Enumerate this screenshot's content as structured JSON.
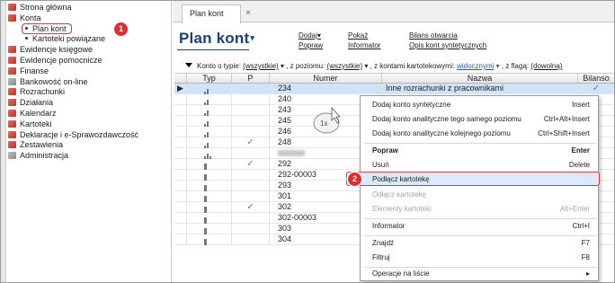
{
  "sidebar": {
    "items": [
      {
        "label": "Strona główna",
        "icon": "red"
      },
      {
        "label": "Konta",
        "icon": "red"
      },
      {
        "label": "Plan kont",
        "level": 2
      },
      {
        "label": "Kartoteki powiązane",
        "level": 2
      },
      {
        "label": "Ewidencje księgowe",
        "icon": "red"
      },
      {
        "label": "Ewidencje pomocnicze",
        "icon": "red"
      },
      {
        "label": "Finanse",
        "icon": "red"
      },
      {
        "label": "Bankowość on-line",
        "icon": "gray"
      },
      {
        "label": "Rozrachunki",
        "icon": "red"
      },
      {
        "label": "Działania",
        "icon": "red"
      },
      {
        "label": "Kalendarz",
        "icon": "red"
      },
      {
        "label": "Kartoteki",
        "icon": "red"
      },
      {
        "label": "Deklaracje i e-Sprawozdawczość",
        "icon": "red"
      },
      {
        "label": "Zestawienia",
        "icon": "red"
      },
      {
        "label": "Administracja",
        "icon": "gray"
      }
    ]
  },
  "badges": {
    "one": "1",
    "two": "2"
  },
  "tab": {
    "label": "Plan kont",
    "close": "×"
  },
  "page": {
    "title": "Plan kont",
    "title_arrow": "▾"
  },
  "links": {
    "col1": [
      "Dodaj▾",
      "Popraw"
    ],
    "col2": [
      "Pokaż",
      "Informator"
    ],
    "col3": [
      "Bilans otwarcia",
      "Opis kont syntetycznych"
    ]
  },
  "filter": {
    "t1": "Konto o typie: ",
    "v1": "(wszystkie)",
    "t2": " , z poziomu: ",
    "v2": "(wszystkie)",
    "t3": " , z kontami kartotekowymi: ",
    "v3": "widocznymi",
    "t4": " , z flagą: ",
    "v4": "(dowolną)"
  },
  "grid": {
    "headers": {
      "typ": "Typ",
      "p": "P",
      "numer": "Numer",
      "nazwa": "Nazwa",
      "bilanso": "Bilanso"
    },
    "rows": [
      {
        "numer": "234",
        "nazwa": "Inne rozrachunki z pracownikami",
        "p": "",
        "check": "✓",
        "sel": true
      },
      {
        "numer": "240",
        "p": "",
        "check": ""
      },
      {
        "numer": "243",
        "p": "",
        "check": ""
      },
      {
        "numer": "245",
        "p": "",
        "check": ""
      },
      {
        "numer": "246",
        "p": "",
        "check": ""
      },
      {
        "numer": "248",
        "p": "✓",
        "check": ""
      },
      {
        "numer": "",
        "p": "",
        "check": "",
        "blur": true
      },
      {
        "numer": "292",
        "p": "✓",
        "check": ""
      },
      {
        "numer": "292-00003",
        "p": "",
        "check": ""
      },
      {
        "numer": "293",
        "p": "",
        "check": ""
      },
      {
        "numer": "301",
        "p": "",
        "check": ""
      },
      {
        "numer": "302",
        "p": "✓",
        "check": ""
      },
      {
        "numer": "302-00003",
        "p": "",
        "check": ""
      },
      {
        "numer": "303",
        "p": "",
        "check": ""
      },
      {
        "numer": "304",
        "p": "",
        "check": ""
      }
    ]
  },
  "menu": {
    "items": [
      {
        "label": "Dodaj konto syntetyczne",
        "shortcut": "Insert"
      },
      {
        "label": "Dodaj konto analityczne tego samego poziomu",
        "shortcut": "Ctrl+Alt+Insert"
      },
      {
        "label": "Dodaj konto analityczne kolejnego poziomu",
        "shortcut": "Ctrl+Shift+Insert"
      },
      {
        "label": "Popraw",
        "shortcut": "Enter"
      },
      {
        "label": "Usuń",
        "shortcut": "Delete"
      },
      {
        "label": "Podłącz kartotekę",
        "shortcut": ""
      },
      {
        "label": "Odłącz kartotekę",
        "shortcut": ""
      },
      {
        "label": "Elementy kartoteki",
        "shortcut": "Alt+Enter"
      },
      {
        "label": "Informator",
        "shortcut": "Ctrl+I"
      },
      {
        "label": "Znajdź",
        "shortcut": "F7"
      },
      {
        "label": "Filtruj",
        "shortcut": "F8"
      },
      {
        "label": "Operacje na liście",
        "shortcut": "▸"
      }
    ]
  },
  "cursor": {
    "label": "1x"
  }
}
